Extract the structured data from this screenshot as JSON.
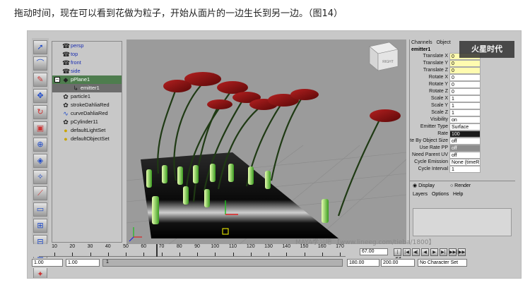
{
  "caption": "拖动时间，现在可以看到花做为粒子，开始从面片的一边生长到另一边。（图14）",
  "toolbox": {
    "tools": [
      {
        "icon": "select-tool-icon",
        "glyph": "➚",
        "color": "blue"
      },
      {
        "icon": "lasso-tool-icon",
        "glyph": "⌒",
        "color": "blue"
      },
      {
        "icon": "paint-select-icon",
        "glyph": "✎",
        "color": "red"
      },
      {
        "icon": "move-tool-icon",
        "glyph": "✥",
        "color": "blue"
      },
      {
        "icon": "rotate-tool-icon",
        "glyph": "↻",
        "color": "red"
      },
      {
        "icon": "scale-tool-icon",
        "glyph": "▣",
        "color": "red"
      },
      {
        "icon": "manipulator-icon",
        "glyph": "⊕",
        "color": "blue"
      },
      {
        "icon": "soft-mod-icon",
        "glyph": "◈",
        "color": "blue"
      },
      {
        "icon": "show-manip-icon",
        "glyph": "✧",
        "color": "blue"
      },
      {
        "icon": "lattice-icon",
        "glyph": "⟋",
        "color": "red"
      },
      {
        "icon": "single-view-icon",
        "glyph": "▭",
        "color": "blue"
      },
      {
        "icon": "four-view-icon",
        "glyph": "⊞",
        "color": "blue"
      },
      {
        "icon": "layout-icon",
        "glyph": "⊟",
        "color": "blue"
      },
      {
        "icon": "outliner-layout-icon",
        "glyph": "☰",
        "color": "blue"
      },
      {
        "icon": "maya-logo-icon",
        "glyph": "✦",
        "color": "red"
      }
    ]
  },
  "outliner": {
    "items": [
      {
        "label": "persp",
        "type": "camera",
        "icon": "camera-icon"
      },
      {
        "label": "top",
        "type": "camera",
        "icon": "camera-icon"
      },
      {
        "label": "front",
        "type": "camera",
        "icon": "camera-icon"
      },
      {
        "label": "side",
        "type": "camera",
        "icon": "camera-icon"
      },
      {
        "label": "pPlane1",
        "type": "selected",
        "icon": "plane-icon",
        "expand": "−"
      },
      {
        "label": "emitter1",
        "type": "child",
        "icon": "emitter-icon"
      },
      {
        "label": "particle1",
        "type": "node",
        "icon": "particle-icon"
      },
      {
        "label": "strokeDahliaRed",
        "type": "node",
        "icon": "stroke-icon"
      },
      {
        "label": "curveDahliaRed",
        "type": "curve",
        "icon": "curve-icon"
      },
      {
        "label": "pCylinder11",
        "type": "node",
        "icon": "cylinder-icon"
      },
      {
        "label": "defaultLightSet",
        "type": "set",
        "icon": "set-icon"
      },
      {
        "label": "defaultObjectSet",
        "type": "set",
        "icon": "set-icon"
      }
    ]
  },
  "channel_box": {
    "tabs": [
      "Channels",
      "Object"
    ],
    "node": "emitter1",
    "logo": "火星时代",
    "rows": [
      {
        "label": "Translate X",
        "value": "0",
        "style": "yellow"
      },
      {
        "label": "Translate Y",
        "value": "0",
        "style": "yellow"
      },
      {
        "label": "Translate Z",
        "value": "0",
        "style": "yellow"
      },
      {
        "label": "Rotate X",
        "value": "0",
        "style": "white"
      },
      {
        "label": "Rotate Y",
        "value": "0",
        "style": "white"
      },
      {
        "label": "Rotate Z",
        "value": "0",
        "style": "white"
      },
      {
        "label": "Scale X",
        "value": "1",
        "style": "white"
      },
      {
        "label": "Scale Y",
        "value": "1",
        "style": "white"
      },
      {
        "label": "Scale Z",
        "value": "1",
        "style": "white"
      },
      {
        "label": "Visibility",
        "value": "on",
        "style": "white"
      },
      {
        "label": "Emitter Type",
        "value": "Surface",
        "style": "white"
      },
      {
        "label": "Rate",
        "value": "100",
        "style": "dark"
      },
      {
        "label": "te By Object Size",
        "value": "off",
        "style": "white"
      },
      {
        "label": "Use Rate PP",
        "value": "off",
        "style": "grey"
      },
      {
        "label": "Need Parent UV",
        "value": "off",
        "style": "white"
      },
      {
        "label": "Cycle Emission",
        "value": "None (timeR",
        "style": "white"
      },
      {
        "label": "Cycle Interval",
        "value": "1",
        "style": "white"
      }
    ]
  },
  "layers": {
    "radio_display": "Display",
    "radio_render": "Render",
    "menu": [
      "Layers",
      "Options",
      "Help"
    ]
  },
  "viewcube": {
    "label": "RIGHT"
  },
  "timeline": {
    "ticks": [
      "10",
      "20",
      "30",
      "40",
      "50",
      "60",
      "70",
      "80",
      "90",
      "100",
      "110",
      "120",
      "130",
      "140",
      "150",
      "160",
      "170"
    ],
    "current_frame": "67.00",
    "playback_buttons": [
      "|◀◀",
      "|◀",
      "◀|",
      "◀",
      "▶",
      "▶|",
      "▶▶|",
      "▶▶"
    ]
  },
  "range": {
    "start": "1.00",
    "start_inner": "1.00",
    "slider_start": "1",
    "end_inner": "180.00",
    "end": "200.00",
    "character_set": "No Character Set"
  },
  "watermark": "MAYA学习吧 【www.lineeg.com/tieba/1800】"
}
